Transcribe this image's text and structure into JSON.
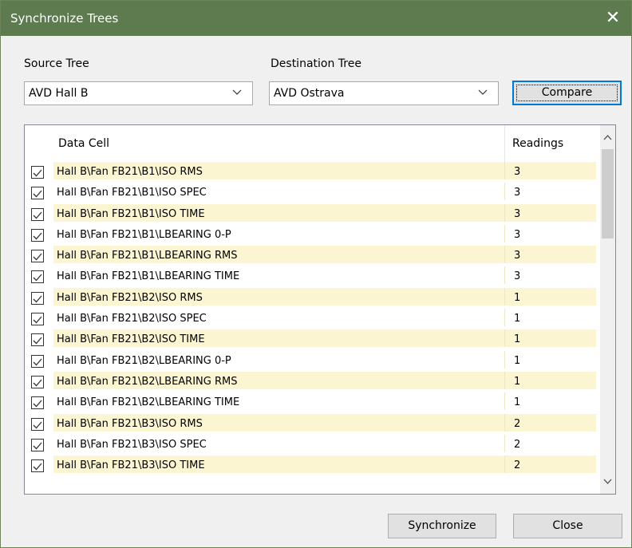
{
  "window": {
    "title": "Synchronize Trees",
    "close_glyph": "✕"
  },
  "source": {
    "label": "Source Tree",
    "value": "AVD Hall B"
  },
  "destination": {
    "label": "Destination Tree",
    "value": "AVD Ostrava"
  },
  "buttons": {
    "compare": "Compare",
    "synchronize": "Synchronize",
    "close": "Close"
  },
  "table": {
    "columns": [
      "Data Cell",
      "Readings"
    ],
    "rows": [
      {
        "checked": true,
        "name": "Hall B\\Fan FB21\\B1\\ISO RMS",
        "readings": "3"
      },
      {
        "checked": true,
        "name": "Hall B\\Fan FB21\\B1\\ISO SPEC",
        "readings": "3"
      },
      {
        "checked": true,
        "name": "Hall B\\Fan FB21\\B1\\ISO TIME",
        "readings": "3"
      },
      {
        "checked": true,
        "name": "Hall B\\Fan FB21\\B1\\LBEARING 0-P",
        "readings": "3"
      },
      {
        "checked": true,
        "name": "Hall B\\Fan FB21\\B1\\LBEARING RMS",
        "readings": "3"
      },
      {
        "checked": true,
        "name": "Hall B\\Fan FB21\\B1\\LBEARING TIME",
        "readings": "3"
      },
      {
        "checked": true,
        "name": "Hall B\\Fan FB21\\B2\\ISO RMS",
        "readings": "1"
      },
      {
        "checked": true,
        "name": "Hall B\\Fan FB21\\B2\\ISO SPEC",
        "readings": "1"
      },
      {
        "checked": true,
        "name": "Hall B\\Fan FB21\\B2\\ISO TIME",
        "readings": "1"
      },
      {
        "checked": true,
        "name": "Hall B\\Fan FB21\\B2\\LBEARING 0-P",
        "readings": "1"
      },
      {
        "checked": true,
        "name": "Hall B\\Fan FB21\\B2\\LBEARING RMS",
        "readings": "1"
      },
      {
        "checked": true,
        "name": "Hall B\\Fan FB21\\B2\\LBEARING TIME",
        "readings": "1"
      },
      {
        "checked": true,
        "name": "Hall B\\Fan FB21\\B3\\ISO RMS",
        "readings": "2"
      },
      {
        "checked": true,
        "name": "Hall B\\Fan FB21\\B3\\ISO SPEC",
        "readings": "2"
      },
      {
        "checked": true,
        "name": "Hall B\\Fan FB21\\B3\\ISO TIME",
        "readings": "2"
      }
    ]
  },
  "colors": {
    "title_bar": "#5d7b4f",
    "row_highlight": "#fbf5d2",
    "focus_border": "#0078d7"
  },
  "icons": {
    "close": "close-icon",
    "dropdown": "chevron-down-icon",
    "check": "check-icon",
    "scroll_up": "scroll-up-icon",
    "scroll_down": "scroll-down-icon"
  }
}
